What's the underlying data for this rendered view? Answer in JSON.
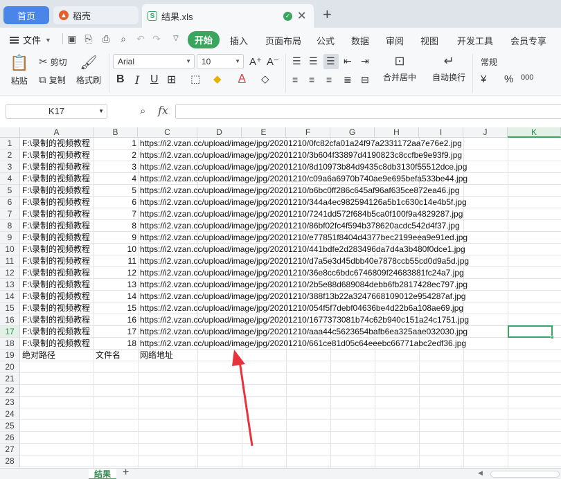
{
  "tabs": {
    "home": "首页",
    "daoke": "稻壳",
    "file": "结果.xls"
  },
  "menu": {
    "file": "文件",
    "tabs": [
      "开始",
      "插入",
      "页面布局",
      "公式",
      "数据",
      "审阅",
      "视图",
      "开发工具",
      "会员专享"
    ],
    "active": "开始"
  },
  "ribbon": {
    "paste": "粘贴",
    "cut": "剪切",
    "copy": "复制",
    "format_painter": "格式刷",
    "font_name": "Arial",
    "font_size": "10",
    "merge_center": "合并居中",
    "auto_wrap": "自动换行",
    "number_format": "常规",
    "currency": "¥",
    "percent": "%",
    "thousands": "000"
  },
  "formula_bar": {
    "cell_ref": "K17",
    "fx": "fx",
    "value": ""
  },
  "grid": {
    "columns": [
      "A",
      "B",
      "C",
      "D",
      "E",
      "F",
      "G",
      "H",
      "I",
      "J",
      "K"
    ],
    "selected_col": "K",
    "selected_row": "17",
    "row_numbers": [
      "1",
      "2",
      "3",
      "4",
      "5",
      "6",
      "7",
      "8",
      "9",
      "10",
      "11",
      "12",
      "13",
      "14",
      "15",
      "16",
      "17",
      "18",
      "19",
      "20",
      "21",
      "22",
      "23",
      "24",
      "25",
      "26",
      "27",
      "28"
    ],
    "path_text": "F:\\录制的视频教程",
    "rows": [
      {
        "b": "1",
        "c": "https://i2.vzan.cc/upload/image/jpg/20201210/0fc82cfa01a24f97a2331172aa7e76e2.jpg"
      },
      {
        "b": "2",
        "c": "https://i2.vzan.cc/upload/image/jpg/20201210/3b604f33897d4190823c8ccfbe9e93f9.jpg"
      },
      {
        "b": "3",
        "c": "https://i2.vzan.cc/upload/image/jpg/20201210/8d10973b84d9435c8db3130f55512dce.jpg"
      },
      {
        "b": "4",
        "c": "https://i2.vzan.cc/upload/image/jpg/20201210/c09a6a6970b740ae9e695befa533be44.jpg"
      },
      {
        "b": "5",
        "c": "https://i2.vzan.cc/upload/image/jpg/20201210/b6bc0ff286c645af96af635ce872ea46.jpg"
      },
      {
        "b": "6",
        "c": "https://i2.vzan.cc/upload/image/jpg/20201210/344a4ec982594126a5b1c630c14e4b5f.jpg"
      },
      {
        "b": "7",
        "c": "https://i2.vzan.cc/upload/image/jpg/20201210/7241dd572f684b5ca0f100f9a4829287.jpg"
      },
      {
        "b": "8",
        "c": "https://i2.vzan.cc/upload/image/jpg/20201210/86bf02fc4f594b378620acdc542d4f37.jpg"
      },
      {
        "b": "9",
        "c": "https://i2.vzan.cc/upload/image/jpg/20201210/e77851f8404d4377bec2199eea9e91ed.jpg"
      },
      {
        "b": "10",
        "c": "https://i2.vzan.cc/upload/image/jpg/20201210/441bdfe2d283496da7d4a3b480f0dce1.jpg"
      },
      {
        "b": "11",
        "c": "https://i2.vzan.cc/upload/image/jpg/20201210/d7a5e3d45dbb40e7878ccb55cd0d9a5d.jpg"
      },
      {
        "b": "12",
        "c": "https://i2.vzan.cc/upload/image/jpg/20201210/36e8cc6bdc6746809f24683881fc24a7.jpg"
      },
      {
        "b": "13",
        "c": "https://i2.vzan.cc/upload/image/jpg/20201210/2b5e88d689084debb6fb2817428ec797.jpg"
      },
      {
        "b": "14",
        "c": "https://i2.vzan.cc/upload/image/jpg/20201210/388f13b22a3247668109012e954287af.jpg"
      },
      {
        "b": "15",
        "c": "https://i2.vzan.cc/upload/image/jpg/20201210/054f5f7debf04636be4d22b6a108ae69.jpg"
      },
      {
        "b": "16",
        "c": "https://i2.vzan.cc/upload/image/jpg/20201210/1677373081b74c62b940c151a24c1751.jpg"
      },
      {
        "b": "17",
        "c": "https://i2.vzan.cc/upload/image/jpg/20201210/aaa44c5623654bafb6ea325aae032030.jpg"
      },
      {
        "b": "18",
        "c": "https://i2.vzan.cc/upload/image/jpg/20201210/661ce81d05c64eeebc66771abc2edf36.jpg"
      }
    ],
    "header_row": {
      "a": "绝对路径",
      "b": "文件名",
      "c": "网络地址"
    }
  },
  "sheets": {
    "active": "结果"
  },
  "colors": {
    "accent": "#3aa55d",
    "home_tab": "#4a86e8",
    "arrow": "#e8323c"
  }
}
